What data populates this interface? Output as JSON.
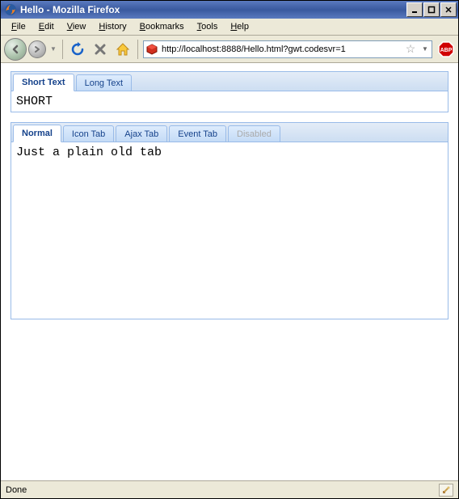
{
  "window": {
    "title": "Hello - Mozilla Firefox",
    "buttons": {
      "min": "_",
      "max": "□",
      "close": "X"
    }
  },
  "menu": {
    "file": "File",
    "edit": "Edit",
    "view": "View",
    "history": "History",
    "bookmarks": "Bookmarks",
    "tools": "Tools",
    "help": "Help"
  },
  "toolbar": {
    "url": "http://localhost:8888/Hello.html?gwt.codesvr=1"
  },
  "panel1": {
    "tabs": {
      "short": "Short Text",
      "long": "Long Text"
    },
    "active": 0,
    "body": "SHORT"
  },
  "panel2": {
    "tabs": {
      "normal": "Normal",
      "icon": "Icon Tab",
      "ajax": "Ajax Tab",
      "event": "Event Tab",
      "disabled": "Disabled"
    },
    "active": 0,
    "body": "Just a plain old tab"
  },
  "status": {
    "text": "Done"
  }
}
